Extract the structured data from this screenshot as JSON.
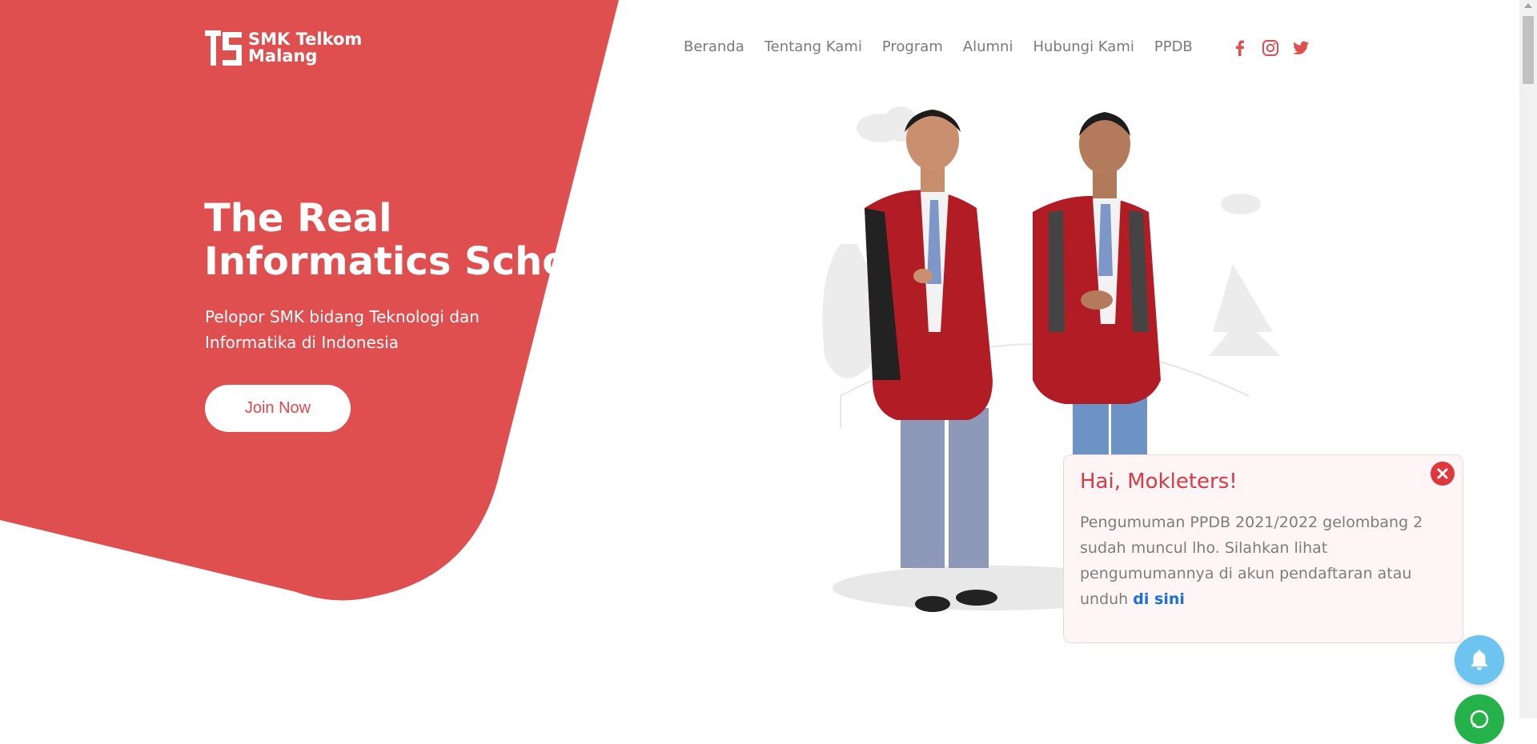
{
  "brand": {
    "line1": "SMK Telkom",
    "line2": "Malang"
  },
  "colors": {
    "primary_red": "#e04f4f",
    "nav_text": "#7a7a7a",
    "popup_title": "#d93a44",
    "link_blue": "#1a6fe0",
    "bell_blue": "#6cc4ef",
    "whatsapp_green": "#26b24a"
  },
  "nav": {
    "items": [
      {
        "label": "Beranda"
      },
      {
        "label": "Tentang Kami"
      },
      {
        "label": "Program"
      },
      {
        "label": "Alumni"
      },
      {
        "label": "Hubungi Kami"
      },
      {
        "label": "PPDB"
      }
    ]
  },
  "social": {
    "icons": [
      "facebook-icon",
      "instagram-icon",
      "twitter-icon"
    ]
  },
  "hero": {
    "title_line1": "The Real",
    "title_line2": "Informatics School",
    "subtitle": "Pelopor SMK bidang Teknologi dan Informatika di Indonesia",
    "cta_label": "Join Now"
  },
  "popup": {
    "title": "Hai, Mokleters!",
    "body": "Pengumuman PPDB 2021/2022 gelombang 2 sudah muncul lho. Silahkan lihat pengumumannya di akun pendaftaran atau unduh ",
    "link_label": "di sini"
  }
}
